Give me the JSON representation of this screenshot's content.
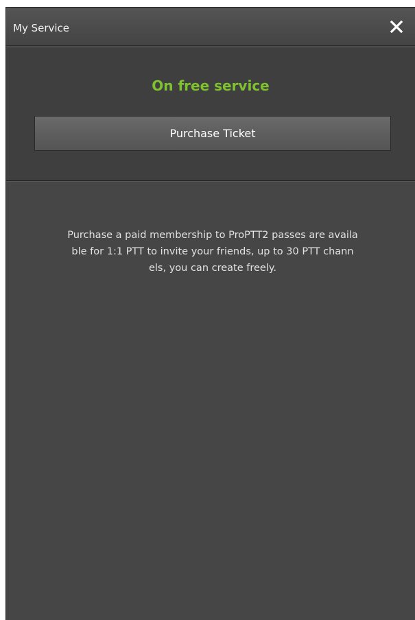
{
  "window": {
    "title": "My Service",
    "close_icon": "close-icon"
  },
  "service": {
    "status": "On free service",
    "purchase_label": "Purchase Ticket"
  },
  "description": {
    "lines": [
      "Purchase a paid membership to ProPTT2 passes are availa",
      "ble for 1:1 PTT to invite your friends, up to 30 PTT chann",
      "els, you can create freely."
    ]
  },
  "colors": {
    "status_green": "#7fc230",
    "panel_background": "#464646"
  }
}
